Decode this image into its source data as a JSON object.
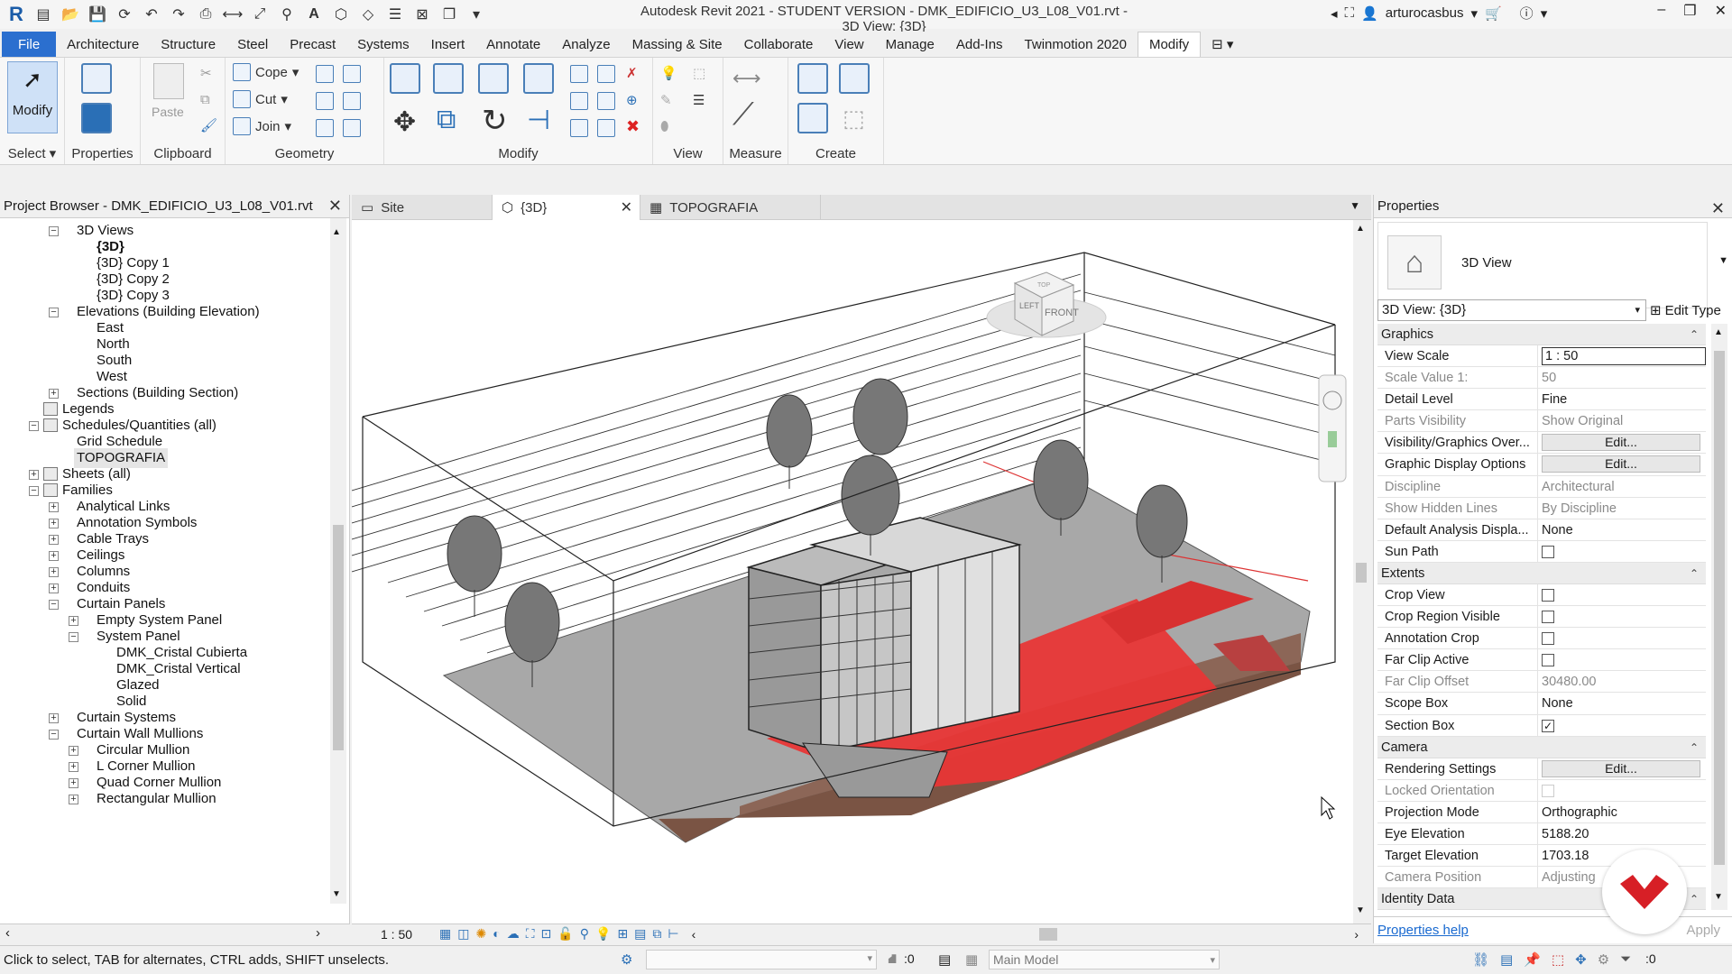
{
  "app": {
    "title": "Autodesk Revit 2021 - STUDENT VERSION - DMK_EDIFICIO_U3_L08_V01.rvt - 3D View: {3D}",
    "user": "arturocasbus"
  },
  "menu": {
    "tabs": [
      "File",
      "Architecture",
      "Structure",
      "Steel",
      "Precast",
      "Systems",
      "Insert",
      "Annotate",
      "Analyze",
      "Massing & Site",
      "Collaborate",
      "View",
      "Manage",
      "Add-Ins",
      "Twinmotion 2020",
      "Modify"
    ],
    "active": "Modify"
  },
  "ribbon": {
    "modify_label": "Modify",
    "select_label": "Select",
    "properties_label": "Properties",
    "clipboard_label": "Clipboard",
    "paste_label": "Paste",
    "geometry_label": "Geometry",
    "cope_label": "Cope",
    "cut_label": "Cut",
    "join_label": "Join",
    "modify_group_label": "Modify",
    "view_label": "View",
    "measure_label": "Measure",
    "create_label": "Create"
  },
  "project_browser": {
    "title": "Project Browser - DMK_EDIFICIO_U3_L08_V01.rvt",
    "items": [
      {
        "label": "3D Views",
        "indent": 1,
        "exp": "-"
      },
      {
        "label": "{3D}",
        "indent": 2,
        "bold": true
      },
      {
        "label": "{3D} Copy 1",
        "indent": 2
      },
      {
        "label": "{3D} Copy 2",
        "indent": 2
      },
      {
        "label": "{3D} Copy 3",
        "indent": 2
      },
      {
        "label": "Elevations (Building Elevation)",
        "indent": 1,
        "exp": "-"
      },
      {
        "label": "East",
        "indent": 2
      },
      {
        "label": "North",
        "indent": 2
      },
      {
        "label": "South",
        "indent": 2
      },
      {
        "label": "West",
        "indent": 2
      },
      {
        "label": "Sections (Building Section)",
        "indent": 1,
        "exp": "+"
      },
      {
        "label": "Legends",
        "indent": 0,
        "icon": true
      },
      {
        "label": "Schedules/Quantities (all)",
        "indent": 0,
        "exp": "-",
        "icon": true
      },
      {
        "label": "Grid Schedule",
        "indent": 1
      },
      {
        "label": "TOPOGRAFIA",
        "indent": 1,
        "selected": true
      },
      {
        "label": "Sheets (all)",
        "indent": 0,
        "exp": "+",
        "icon": true
      },
      {
        "label": "Families",
        "indent": 0,
        "exp": "-",
        "icon": true
      },
      {
        "label": "Analytical Links",
        "indent": 1,
        "exp": "+"
      },
      {
        "label": "Annotation Symbols",
        "indent": 1,
        "exp": "+"
      },
      {
        "label": "Cable Trays",
        "indent": 1,
        "exp": "+"
      },
      {
        "label": "Ceilings",
        "indent": 1,
        "exp": "+"
      },
      {
        "label": "Columns",
        "indent": 1,
        "exp": "+"
      },
      {
        "label": "Conduits",
        "indent": 1,
        "exp": "+"
      },
      {
        "label": "Curtain Panels",
        "indent": 1,
        "exp": "-"
      },
      {
        "label": "Empty System Panel",
        "indent": 2,
        "exp": "+"
      },
      {
        "label": "System Panel",
        "indent": 2,
        "exp": "-"
      },
      {
        "label": "DMK_Cristal Cubierta",
        "indent": 3
      },
      {
        "label": "DMK_Cristal Vertical",
        "indent": 3
      },
      {
        "label": "Glazed",
        "indent": 3
      },
      {
        "label": "Solid",
        "indent": 3
      },
      {
        "label": "Curtain Systems",
        "indent": 1,
        "exp": "+"
      },
      {
        "label": "Curtain Wall Mullions",
        "indent": 1,
        "exp": "-"
      },
      {
        "label": "Circular Mullion",
        "indent": 2,
        "exp": "+"
      },
      {
        "label": "L Corner Mullion",
        "indent": 2,
        "exp": "+"
      },
      {
        "label": "Quad Corner Mullion",
        "indent": 2,
        "exp": "+"
      },
      {
        "label": "Rectangular Mullion",
        "indent": 2,
        "exp": "+"
      }
    ]
  },
  "view_tabs": [
    {
      "label": "Site"
    },
    {
      "label": "{3D}",
      "active": true
    },
    {
      "label": "TOPOGRAFIA"
    }
  ],
  "viewcube": {
    "front": "FRONT",
    "left": "LEFT",
    "top": "TOP"
  },
  "view_control": {
    "scale": "1 : 50"
  },
  "properties": {
    "title": "Properties",
    "type": "3D View",
    "instance": "3D View: {3D}",
    "edit_type": "Edit Type",
    "groups": [
      {
        "name": "Graphics",
        "rows": [
          {
            "k": "View Scale",
            "v": "1 : 50",
            "input": true
          },
          {
            "k": "Scale Value    1:",
            "v": "50",
            "dim": true
          },
          {
            "k": "Detail Level",
            "v": "Fine"
          },
          {
            "k": "Parts Visibility",
            "v": "Show Original",
            "dim": true
          },
          {
            "k": "Visibility/Graphics Over...",
            "v": "Edit...",
            "btn": true
          },
          {
            "k": "Graphic Display Options",
            "v": "Edit...",
            "btn": true
          },
          {
            "k": "Discipline",
            "v": "Architectural",
            "dim": true
          },
          {
            "k": "Show Hidden Lines",
            "v": "By Discipline",
            "dim": true
          },
          {
            "k": "Default Analysis Displa...",
            "v": "None"
          },
          {
            "k": "Sun Path",
            "chk": false
          }
        ]
      },
      {
        "name": "Extents",
        "rows": [
          {
            "k": "Crop View",
            "chk": false
          },
          {
            "k": "Crop Region Visible",
            "chk": false
          },
          {
            "k": "Annotation Crop",
            "chk": false
          },
          {
            "k": "Far Clip Active",
            "chk": false
          },
          {
            "k": "Far Clip Offset",
            "v": "30480.00",
            "dim": true
          },
          {
            "k": "Scope Box",
            "v": "None"
          },
          {
            "k": "Section Box",
            "chk": true
          }
        ]
      },
      {
        "name": "Camera",
        "rows": [
          {
            "k": "Rendering Settings",
            "v": "Edit...",
            "btn": true
          },
          {
            "k": "Locked Orientation",
            "chk": false,
            "dim": true
          },
          {
            "k": "Projection Mode",
            "v": "Orthographic"
          },
          {
            "k": "Eye Elevation",
            "v": "5188.20"
          },
          {
            "k": "Target Elevation",
            "v": "1703.18"
          },
          {
            "k": "Camera Position",
            "v": "Adjusting",
            "dim": true
          }
        ]
      },
      {
        "name": "Identity Data",
        "rows": []
      }
    ],
    "help": "Properties help",
    "apply": "Apply"
  },
  "status": {
    "message": "Click to select, TAB for alternates, CTRL adds, SHIFT unselects.",
    "model": "Main Model",
    "count": ":0",
    "filter": ":0"
  },
  "colors": {
    "accent": "#2b6fcf",
    "red": "#e03030",
    "logo_red": "#d71f26"
  }
}
